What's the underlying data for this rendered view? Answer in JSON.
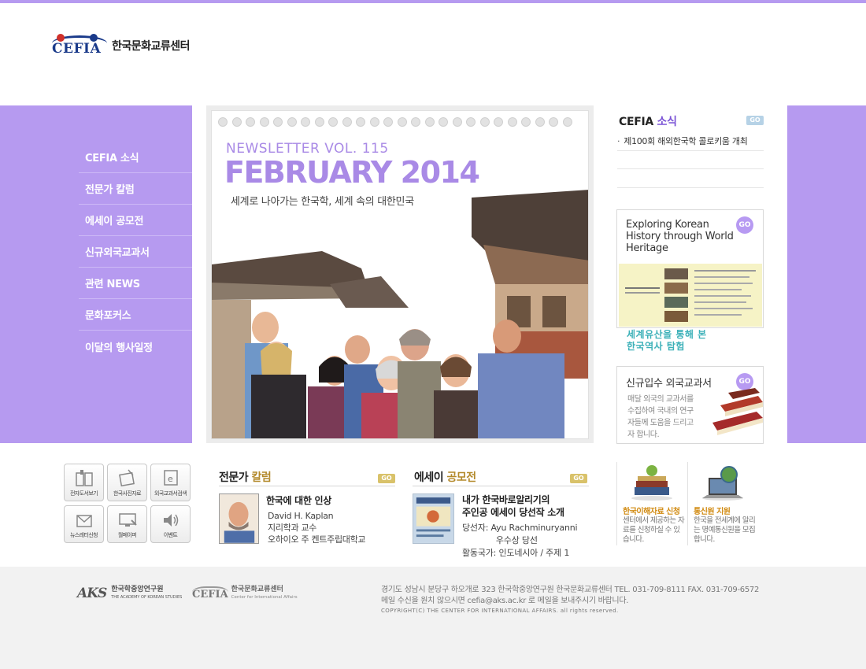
{
  "brand": {
    "logo_text": "CEFIA",
    "name": "한국문화교류센터"
  },
  "left_nav": [
    {
      "label": "CEFIA 소식"
    },
    {
      "label": "전문가 칼럼"
    },
    {
      "label": "에세이 공모전"
    },
    {
      "label": "신규외국교과서"
    },
    {
      "label": "관련 NEWS"
    },
    {
      "label": "문화포커스"
    },
    {
      "label": "이달의 행사일정"
    }
  ],
  "feature": {
    "volume": "NEWSLETTER VOL. 115",
    "month": "FEBRUARY 2014",
    "subtitle": "세계로 나아가는 한국학, 세계 속의 대한민국"
  },
  "news": {
    "title_main": "CEFIA",
    "title_accent": "소식",
    "go": "GO",
    "items": [
      {
        "text": "제100회 해외한국학 콜로키움 개최"
      },
      {
        "text": ""
      },
      {
        "text": ""
      }
    ]
  },
  "heritage_box": {
    "title_line1": "Exploring Korean",
    "title_line2": "History through World",
    "title_line3": "Heritage",
    "go": "GO",
    "caption_line1": "세계유산을 통해 본",
    "caption_line2": "한국역사 탐험"
  },
  "books_box": {
    "title": "신규입수 외국교과서",
    "go": "GO",
    "desc": "매달 외국의 교과서를 수집하여 국내의 연구자들께 도움을 드리고자 합니다."
  },
  "quick_links": [
    {
      "label": "전자도서보기",
      "icon": "book-icon"
    },
    {
      "label": "한국사진자료",
      "icon": "photo-icon"
    },
    {
      "label": "외국교과서검색",
      "icon": "e-book-search-icon"
    },
    {
      "label": "뉴스레터신청",
      "icon": "envelope-icon"
    },
    {
      "label": "월페이퍼",
      "icon": "monitor-icon"
    },
    {
      "label": "이벤트",
      "icon": "speaker-icon"
    }
  ],
  "column": {
    "title_main": "전문가",
    "title_accent": "칼럼",
    "go": "GO",
    "headline": "한국에 대한 인상",
    "author": "David H. Kaplan",
    "role": "지리학과 교수",
    "affiliation": "오하이오 주 켄트주립대학교"
  },
  "essay": {
    "title_main": "에세이",
    "title_accent": "공모전",
    "go": "GO",
    "headline_line1": "내가 한국바로알리기의",
    "headline_line2": "주인공 에세이 당선작 소개",
    "meta": "당선자: Ayu Rachminuryanni\n             우수상 당선\n활동국가: 인도네시아 / 주제 1"
  },
  "cards": [
    {
      "title": "한국이해자료 신청",
      "desc": "센터에서 제공하는 자료를 신청하실 수 있습니다.",
      "icon": "books-apple-icon"
    },
    {
      "title": "통신원 지원",
      "desc": "한국을 전세계에 알리는 명예통신원을 모집합니다.",
      "icon": "laptop-globe-icon"
    }
  ],
  "footer": {
    "aks_mark": "AKS",
    "aks_name": "한국학중앙연구원",
    "aks_name_en": "THE ACADEMY OF KOREAN STUDIES",
    "cefia_mark": "CEFIA",
    "cefia_name": "한국문화교류센터",
    "cefia_name_en": "Center for International Affairs",
    "address": "경기도 성남시 분당구 하오개로 323 한국학중앙연구원 한국문화교류센터    TEL. 031-709-8111   FAX. 031-709-6572",
    "email_line": "메일 수신을 원치 않으시면 cefia@aks.ac.kr 로 메일을 보내주시기 바랍니다.",
    "copyright": "COPYRIGHT(C) THE CENTER FOR INTERNATIONAL AFFAIRS.  all rights reserved."
  },
  "colors": {
    "accent_purple": "#b69af0",
    "title_purple": "#a98ae6",
    "gold": "#b3892a",
    "teal": "#3bb0b8"
  }
}
